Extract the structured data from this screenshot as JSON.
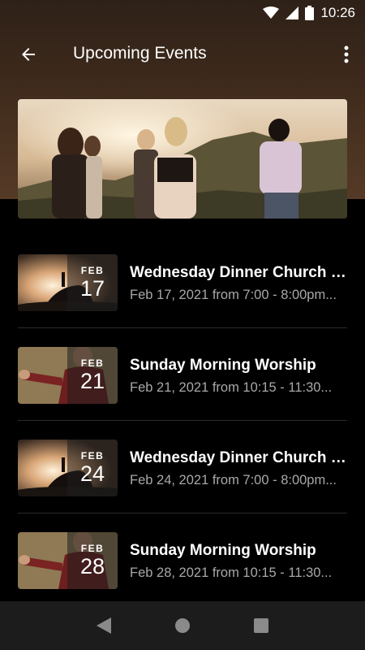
{
  "status_bar": {
    "time": "10:26",
    "icons": [
      "wifi-icon",
      "cell-signal-icon",
      "battery-icon"
    ]
  },
  "app_bar": {
    "title": "Upcoming Events",
    "back_icon": "arrow-left-icon",
    "menu_icon": "more-vertical-icon"
  },
  "hero": {
    "image": "group-of-people-at-sunset-photo"
  },
  "events": [
    {
      "month": "FEB",
      "day": "17",
      "title": "Wednesday Dinner Church B...",
      "time": "Feb 17, 2021 from 7:00 - 8:00pm...",
      "thumbnail": "sunset-rock-silhouette-photo"
    },
    {
      "month": "FEB",
      "day": "21",
      "title": "Sunday Morning Worship",
      "time": "Feb 21, 2021 from 10:15 - 11:30...",
      "thumbnail": "preacher-photo"
    },
    {
      "month": "FEB",
      "day": "24",
      "title": "Wednesday Dinner Church B...",
      "time": "Feb 24, 2021 from 7:00 - 8:00pm...",
      "thumbnail": "sunset-rock-silhouette-photo"
    },
    {
      "month": "FEB",
      "day": "28",
      "title": "Sunday Morning Worship",
      "time": "Feb 28, 2021 from 10:15 - 11:30...",
      "thumbnail": "preacher-photo"
    }
  ],
  "nav_bar": {
    "icons": [
      "back-triangle-icon",
      "home-circle-icon",
      "recents-square-icon"
    ]
  },
  "colors": {
    "background": "#000000",
    "header_brown": "#4a3221",
    "text_primary": "#ffffff",
    "text_secondary": "#a8a8a8",
    "nav_bar": "#1c1c1c"
  }
}
